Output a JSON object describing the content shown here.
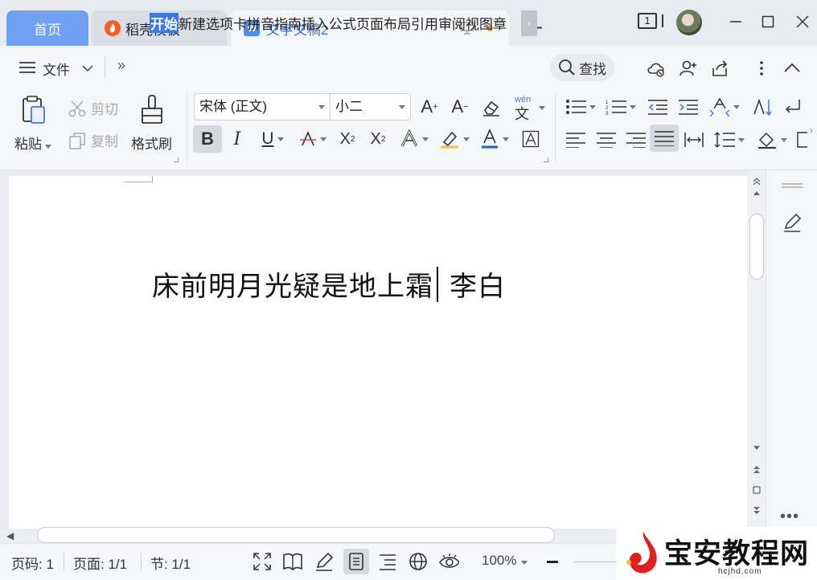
{
  "tabs": {
    "home": "首页",
    "template": "稻壳模板",
    "document": "文字文稿2",
    "doc_icon_letter": "W",
    "new_tab": "+"
  },
  "window": {
    "workspace_count": "1"
  },
  "menu": {
    "file_label": "文件",
    "more_label": "»",
    "tabs": [
      "开始",
      "新建选项卡",
      "拼音指南",
      "插入",
      "公式",
      "页面布局",
      "引用",
      "审阅",
      "视图",
      "章"
    ],
    "active_tab": "开始",
    "search_label": "查找",
    "scroll_right": "›"
  },
  "ribbon": {
    "paste_label": "粘贴",
    "cut_label": "剪切",
    "copy_label": "复制",
    "format_painter_label": "格式刷",
    "font_name": "宋体 (正文)",
    "font_size": "小二",
    "bold_label": "B",
    "italic_label": "I",
    "underline_label": "U",
    "pinyin_label": "wén",
    "highlight_color": "#f0c040",
    "font_color": "#2060d0"
  },
  "document": {
    "text_before_cursor": "床前明月光疑是地上霜",
    "text_after_cursor": "李白"
  },
  "status": {
    "page_num": "页码: 1",
    "pages": "页面: 1/1",
    "section": "节: 1/1",
    "zoom": "100%"
  },
  "watermark": {
    "title": "宝安教程网",
    "url": "hcjhd.com"
  },
  "colors": {
    "accent": "#3b78e7",
    "home_tab": "#6fa0f4",
    "template_logo": "#ff5a1f"
  }
}
